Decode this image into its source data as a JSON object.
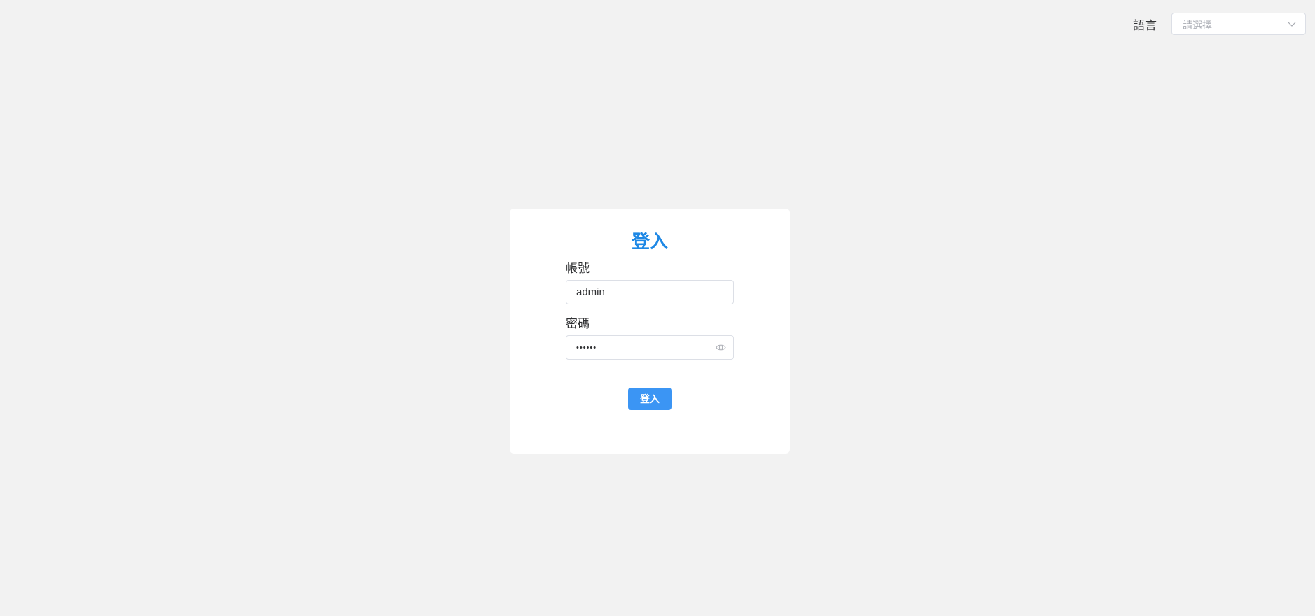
{
  "header": {
    "language_label": "語言",
    "language_select": {
      "placeholder": "請選擇",
      "selected": ""
    }
  },
  "login": {
    "title": "登入",
    "account_label": "帳號",
    "account_value": "admin",
    "password_label": "密碼",
    "password_value": "••••••",
    "submit_label": "登入"
  },
  "colors": {
    "accent": "#1e88e5",
    "button": "#3b95f4",
    "background": "#f2f2f2"
  },
  "icons": {
    "select_arrow": "chevron-down-icon",
    "password_toggle": "eye-icon"
  }
}
